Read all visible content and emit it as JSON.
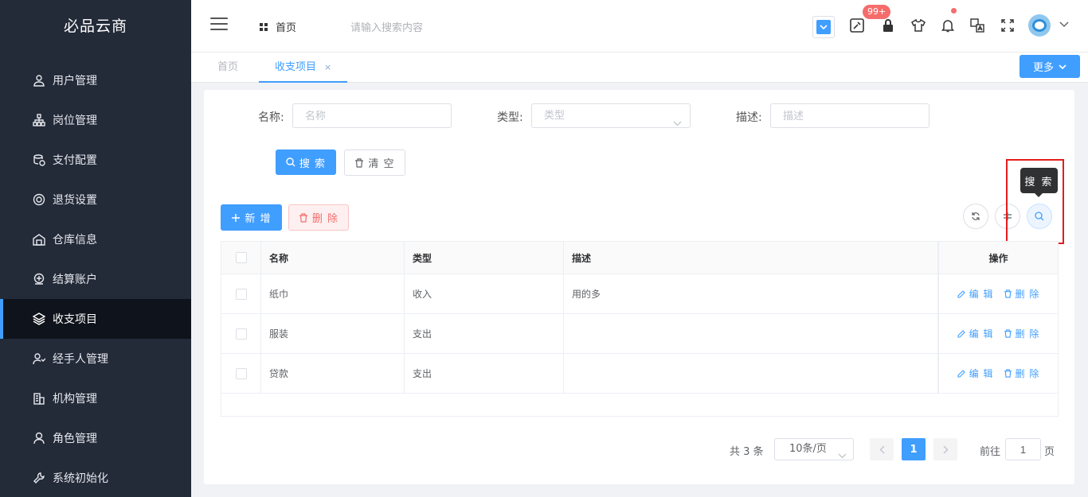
{
  "brand": "必品云商",
  "sidebar": {
    "items": [
      {
        "label": "用户管理",
        "icon": "user-icon"
      },
      {
        "label": "岗位管理",
        "icon": "org-tree-icon"
      },
      {
        "label": "支付配置",
        "icon": "coins-icon"
      },
      {
        "label": "退货设置",
        "icon": "return-icon"
      },
      {
        "label": "仓库信息",
        "icon": "warehouse-icon"
      },
      {
        "label": "结算账户",
        "icon": "account-icon"
      },
      {
        "label": "收支项目",
        "icon": "layers-icon",
        "active": true
      },
      {
        "label": "经手人管理",
        "icon": "handler-icon"
      },
      {
        "label": "机构管理",
        "icon": "building-icon"
      },
      {
        "label": "角色管理",
        "icon": "role-icon"
      },
      {
        "label": "系统初始化",
        "icon": "wrench-icon"
      }
    ]
  },
  "header": {
    "home_label": "首页",
    "search_placeholder": "请输入搜索内容",
    "badge": "99+"
  },
  "tabs": {
    "home": "首页",
    "active": "收支项目",
    "close": "×",
    "more": "更多"
  },
  "filters": {
    "name_label": "名称:",
    "name_placeholder": "名称",
    "type_label": "类型:",
    "type_placeholder": "类型",
    "desc_label": "描述:",
    "desc_placeholder": "描述"
  },
  "buttons": {
    "search": "搜 索",
    "clear": "清 空",
    "add": "新 增",
    "delete": "删 除"
  },
  "tooltip": "搜 索",
  "table": {
    "headers": {
      "name": "名称",
      "type": "类型",
      "desc": "描述",
      "ops": "操作"
    },
    "rows": [
      {
        "name": "纸巾",
        "type": "收入",
        "desc": "用的多"
      },
      {
        "name": "服装",
        "type": "支出",
        "desc": ""
      },
      {
        "name": "贷款",
        "type": "支出",
        "desc": ""
      }
    ],
    "edit_label": "编 辑",
    "delete_label": "删 除"
  },
  "pagination": {
    "total": "共 3 条",
    "page_size": "10条/页",
    "current": "1",
    "goto_label": "前往",
    "goto_value": "1",
    "page_suffix": "页"
  },
  "colors": {
    "primary": "#409eff",
    "sidebar_bg": "#232a38",
    "danger": "#f56c6c",
    "highlight": "#e51c1c"
  }
}
